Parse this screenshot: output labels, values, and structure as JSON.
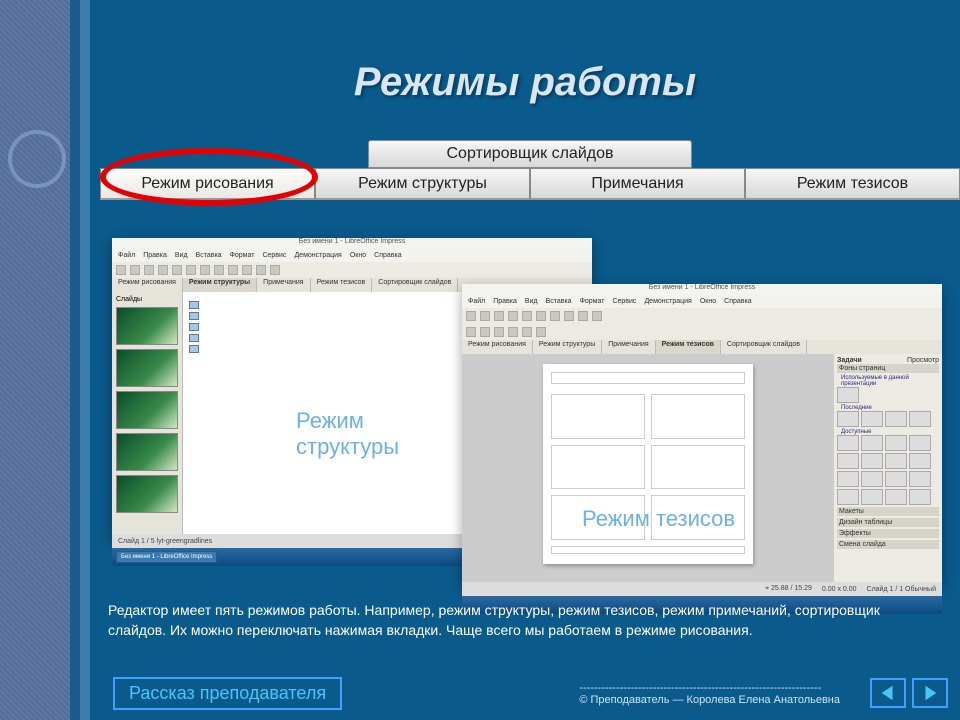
{
  "title": "Режимы работы",
  "tabs": {
    "top_center": "Сортировщик слайдов",
    "items": [
      "Режим рисования",
      "Режим структуры",
      "Примечания",
      "Режим тезисов"
    ],
    "active_index": 0
  },
  "shot1": {
    "window_title": "Без имени 1 - LibreOffice Impress",
    "menus": [
      "Файл",
      "Правка",
      "Вид",
      "Вставка",
      "Формат",
      "Сервис",
      "Демонстрация",
      "Окно",
      "Справка"
    ],
    "subtabs": [
      "Режим рисования",
      "Режим структуры",
      "Примечания",
      "Режим тезисов",
      "Сортировщик слайдов"
    ],
    "subtabs_active": "Режим структуры",
    "side_label": "Слайды",
    "status": "Слайд 1 / 5   lyt-greengradlines",
    "taskbar_items": [
      "Без имени 1 - LibreOffice Impress"
    ]
  },
  "shot2": {
    "window_title": "Без имени 1 - LibreOffice Impress",
    "menus": [
      "Файл",
      "Правка",
      "Вид",
      "Вставка",
      "Формат",
      "Сервис",
      "Демонстрация",
      "Окно",
      "Справка"
    ],
    "subtabs": [
      "Режим рисования",
      "Режим структуры",
      "Примечания",
      "Режим тезисов",
      "Сортировщик слайдов"
    ],
    "subtabs_active": "Режим тезисов",
    "tasks": {
      "title": "Задачи",
      "view": "Просмотр",
      "sections": [
        "Фоны страниц",
        "Используемые в данной презентации",
        "Последние",
        "Доступные",
        "Макеты",
        "Дизайн таблицы",
        "Эффекты",
        "Смена слайда"
      ]
    },
    "status_left": "⌖  25.88 / 15.29",
    "status_mid": "0.00 x 0.00",
    "status_right": "Слайд 1 / 1   Обычный"
  },
  "annotations": {
    "outline": "Режим структуры",
    "handout": "Режим тезисов"
  },
  "description": "Редактор имеет пять режимов работы. Например, режим структуры, режим тезисов, режим примечаний, сортировщик слайдов. Их можно переключать нажимая вкладки. Чаще всего мы работаем в режиме рисования.",
  "footer_badge": "Рассказ преподавателя",
  "credits_dash": "------------------------------------------------------------------",
  "credits": "© Преподаватель — Королева Елена Анатольевна"
}
